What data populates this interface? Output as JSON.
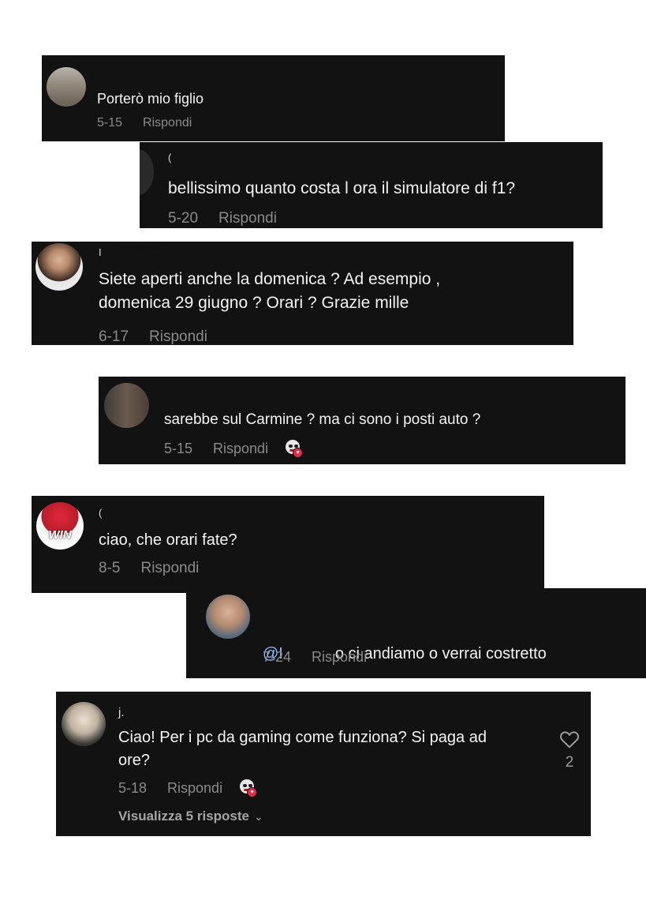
{
  "comments": [
    {
      "user": "",
      "text": "Porterò mio figlio",
      "date": "5-15",
      "reply": "Rispondi"
    },
    {
      "user": "(",
      "text": "bellissimo quanto costa l ora il simulatore di f1?",
      "date": "5-20",
      "reply": "Rispondi"
    },
    {
      "user": "I",
      "text": "Siete aperti anche la domenica ? Ad esempio ,\ndomenica 29 giugno ? Orari ? Grazie mille",
      "date": "6-17",
      "reply": "Rispondi"
    },
    {
      "user": "",
      "text": "sarebbe sul Carmine ? ma ci sono i posti auto ?",
      "date": "5-15",
      "reply": "Rispondi",
      "creator_liked": true
    },
    {
      "user": "(",
      "text": "ciao, che orari fate?",
      "date": "8-5",
      "reply": "Rispondi"
    },
    {
      "user": "",
      "mention": "@I",
      "text": "o ci andiamo o verrai costretto",
      "date": "7-24",
      "reply": "Rispondi"
    },
    {
      "user": "j.",
      "text": "Ciao! Per i pc da gaming come funziona? Si paga ad\nore?",
      "date": "5-18",
      "reply": "Rispondi",
      "creator_liked": true,
      "likes": "2",
      "view_replies": "Visualizza 5 risposte"
    }
  ],
  "avatar_4_text": "WIN",
  "icons": {
    "like": "heart-outline-icon",
    "creator": "creator-liked-icon",
    "chevron": "chevron-down-icon"
  },
  "colors": {
    "card_bg": "#121212",
    "text": "#f3f3f3",
    "meta": "#8a8a8a",
    "heart_badge": "#e32b4a"
  }
}
